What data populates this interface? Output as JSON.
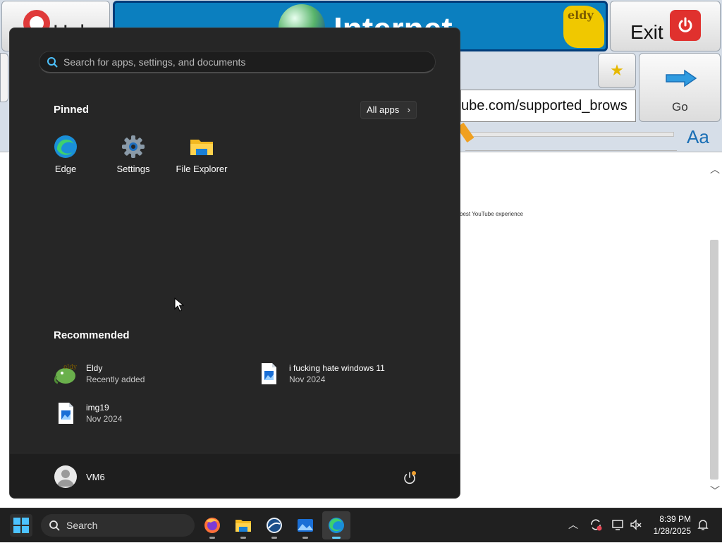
{
  "eldy": {
    "help_label": "Help",
    "banner_title": "Internet",
    "logo_text": "eldy",
    "exit_label": "Exit",
    "url_value": "ube.com/supported_brows",
    "go_label": "Go",
    "font_label": "Aa",
    "page_text": "best YouTube experience"
  },
  "start_menu": {
    "search_placeholder": "Search for apps, settings, and documents",
    "pinned_title": "Pinned",
    "all_apps_label": "All apps",
    "pinned": [
      {
        "label": "Edge",
        "icon": "edge-icon"
      },
      {
        "label": "Settings",
        "icon": "gear-icon"
      },
      {
        "label": "File Explorer",
        "icon": "folder-icon"
      }
    ],
    "recommended_title": "Recommended",
    "recommended": [
      {
        "title": "Eldy",
        "subtitle": "Recently added",
        "icon": "eldy-icon"
      },
      {
        "title": "i fucking hate windows 11",
        "subtitle": "Nov 2024",
        "icon": "image-file-icon"
      },
      {
        "title": "img19",
        "subtitle": "Nov 2024",
        "icon": "image-file-icon"
      }
    ],
    "user_name": "VM6"
  },
  "taskbar": {
    "search_label": "Search",
    "time": "8:39 PM",
    "date": "1/28/2025"
  },
  "colors": {
    "accent": "#60cdff",
    "menu_bg": "#262626",
    "banner_blue": "#0b7fbf",
    "taskbar_bg": "#202020"
  }
}
